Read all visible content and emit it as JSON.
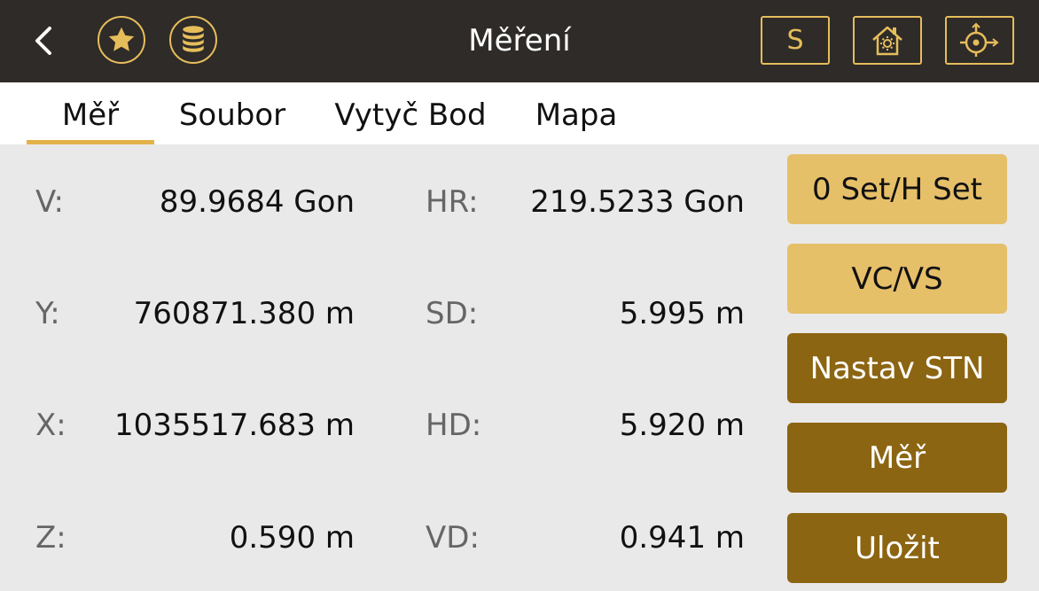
{
  "header": {
    "title": "Měření",
    "s_button": "S",
    "icons": [
      "back-arrow-icon",
      "star-icon",
      "database-icon",
      "home-settings-icon",
      "crosshair-target-icon"
    ]
  },
  "tabs": [
    {
      "label": "Měř",
      "active": true
    },
    {
      "label": "Soubor",
      "active": false
    },
    {
      "label": "Vytyč Bod",
      "active": false
    },
    {
      "label": "Mapa",
      "active": false
    }
  ],
  "measurements": {
    "left": [
      {
        "label": "V:",
        "value": "89.9684 Gon"
      },
      {
        "label": "Y:",
        "value": "760871.380 m"
      },
      {
        "label": "X:",
        "value": "1035517.683 m"
      },
      {
        "label": "Z:",
        "value": "0.590 m"
      }
    ],
    "right": [
      {
        "label": "HR:",
        "value": "219.5233 Gon"
      },
      {
        "label": "SD:",
        "value": "5.995 m"
      },
      {
        "label": "HD:",
        "value": "5.920 m"
      },
      {
        "label": "VD:",
        "value": "0.941 m"
      }
    ]
  },
  "actions": [
    {
      "label": "0 Set/H Set",
      "style": "light"
    },
    {
      "label": "VC/VS",
      "style": "light"
    },
    {
      "label": "Nastav STN",
      "style": "dark"
    },
    {
      "label": "Měř",
      "style": "dark"
    },
    {
      "label": "Uložit",
      "style": "dark"
    }
  ],
  "colors": {
    "accent": "#e6bd5b",
    "header_bg": "#2e2b28",
    "button_light": "#e6bf69",
    "button_dark": "#8c6512",
    "tab_indicator": "#e3b34a"
  }
}
